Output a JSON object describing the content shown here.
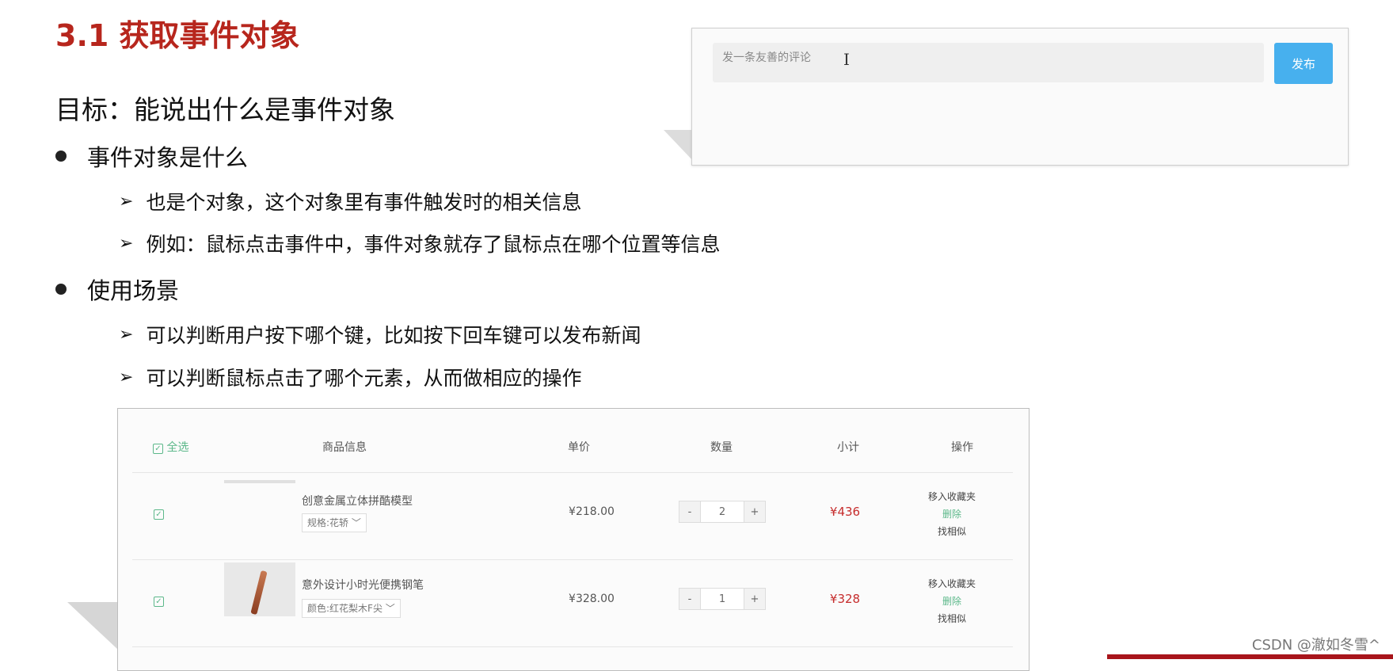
{
  "slide": {
    "title": "3.1 获取事件对象",
    "goal": "目标：能说出什么是事件对象",
    "bullets": [
      {
        "text": "事件对象是什么",
        "subs": [
          "也是个对象，这个对象里有事件触发时的相关信息",
          "例如：鼠标点击事件中，事件对象就存了鼠标点在哪个位置等信息"
        ]
      },
      {
        "text": "使用场景",
        "subs": [
          "可以判断用户按下哪个键，比如按下回车键可以发布新闻",
          "可以判断鼠标点击了哪个元素，从而做相应的操作"
        ]
      }
    ],
    "arrow_glyph": "➢"
  },
  "comment": {
    "placeholder": "发一条友善的评论",
    "publish_label": "发布",
    "cursor_glyph": "I"
  },
  "cart": {
    "select_all": "全选",
    "headers": [
      "商品信息",
      "单价",
      "数量",
      "小计",
      "操作"
    ],
    "rows": [
      {
        "name": "创意金属立体拼酷模型",
        "spec": "规格:花轿 ﹀",
        "price": "¥218.00",
        "qty": "2",
        "subtotal": "¥436",
        "ops": [
          "移入收藏夹",
          "删除",
          "找相似"
        ]
      },
      {
        "name": "意外设计小时光便携钢笔",
        "spec": "颜色:红花梨木F尖 ﹀",
        "price": "¥328.00",
        "qty": "1",
        "subtotal": "¥328",
        "ops": [
          "移入收藏夹",
          "删除",
          "找相似"
        ]
      }
    ],
    "minus": "-",
    "plus": "+",
    "check_glyph": "✓"
  },
  "watermark": "CSDN @澈如冬雪^",
  "colors": {
    "title_red": "#b7261d",
    "publish_blue": "#47b0ee",
    "check_green": "#5cb88a",
    "price_red": "#c62c2c"
  }
}
